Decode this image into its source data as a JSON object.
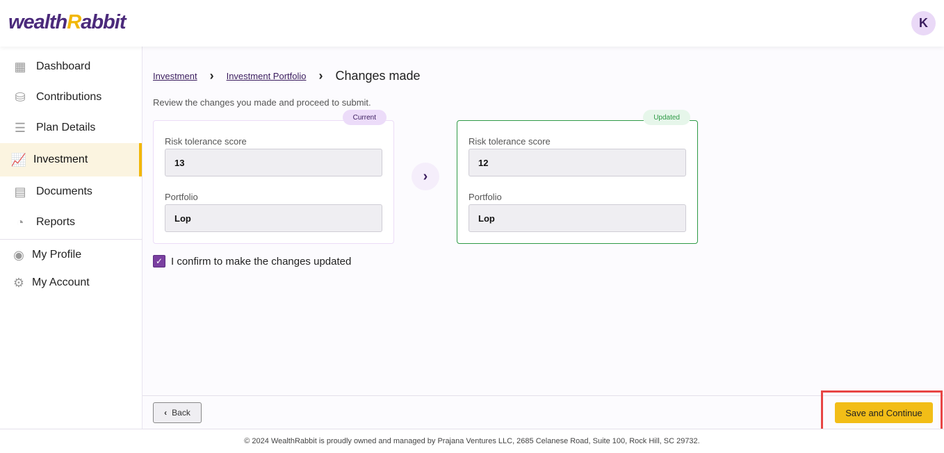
{
  "header": {
    "logo": "wealthRabbit",
    "avatar_initial": "K"
  },
  "sidebar": {
    "items": [
      {
        "label": "Dashboard",
        "icon": "dashboard-icon"
      },
      {
        "label": "Contributions",
        "icon": "coins-icon"
      },
      {
        "label": "Plan Details",
        "icon": "clipboard-icon"
      },
      {
        "label": "Investment",
        "icon": "investment-chart-icon",
        "active": true
      },
      {
        "label": "Documents",
        "icon": "document-icon"
      },
      {
        "label": "Reports",
        "icon": "pie-chart-icon"
      },
      {
        "label": "My Profile",
        "icon": "user-circle-icon"
      },
      {
        "label": "My Account",
        "icon": "user-gear-icon"
      }
    ]
  },
  "breadcrumb": {
    "items": [
      "Investment",
      "Investment Portfolio"
    ],
    "current": "Changes made"
  },
  "subtitle": "Review the changes you made and proceed to submit.",
  "current": {
    "badge": "Current",
    "risk_label": "Risk tolerance score",
    "risk_value": "13",
    "portfolio_label": "Portfolio",
    "portfolio_value": "Lop"
  },
  "updated": {
    "badge": "Updated",
    "risk_label": "Risk tolerance score",
    "risk_value": "12",
    "portfolio_label": "Portfolio",
    "portfolio_value": "Lop"
  },
  "confirm": {
    "label": "I confirm to make the changes updated",
    "checked": true
  },
  "footer": {
    "back": "Back",
    "save": "Save and Continue",
    "copyright": "© 2024 WealthRabbit is proudly owned and managed by Prajana Ventures LLC, 2685 Celanese Road, Suite 100, Rock Hill, SC 29732."
  },
  "colors": {
    "brand": "#4b2a7b",
    "accent": "#f2bd17",
    "updated": "#2e9a45"
  }
}
